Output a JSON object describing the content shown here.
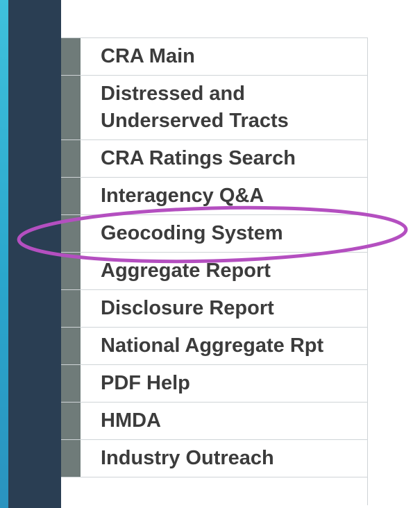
{
  "nav": {
    "items": [
      {
        "label": "CRA Main"
      },
      {
        "label": "Distressed and Underserved Tracts"
      },
      {
        "label": "CRA Ratings Search"
      },
      {
        "label": "Interagency Q&A"
      },
      {
        "label": "Geocoding System"
      },
      {
        "label": "Aggregate Report"
      },
      {
        "label": "Disclosure Report"
      },
      {
        "label": "National Aggregate Rpt"
      },
      {
        "label": "PDF Help"
      },
      {
        "label": "HMDA"
      },
      {
        "label": "Industry Outreach"
      }
    ]
  },
  "annotation": {
    "highlighted_item": "Geocoding System",
    "color": "#b44fc0"
  },
  "theme": {
    "marker_color": "#6f7b79",
    "sidebar_color": "#2a3e53",
    "text_color": "#3c3c3c",
    "border_color": "#cfd4d7"
  }
}
